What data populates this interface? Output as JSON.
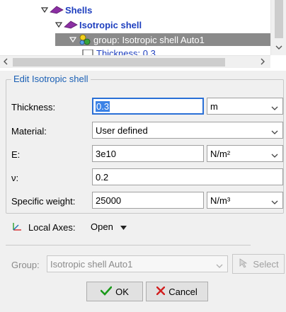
{
  "tree": {
    "items": [
      {
        "label": "Shells",
        "icon": "shell-type-icon"
      },
      {
        "label": "Isotropic shell",
        "icon": "shell-type-icon"
      },
      {
        "label": "group: Isotropic shell Auto1",
        "icon": "group-icon"
      },
      {
        "label": "Thickness: 0.3",
        "icon": "property-icon"
      }
    ]
  },
  "edit": {
    "title": "Edit Isotropic shell",
    "thickness": {
      "label": "Thickness:",
      "value": "0.3",
      "unit": "m"
    },
    "material": {
      "label": "Material:",
      "value": "User defined"
    },
    "e": {
      "label": "E:",
      "value": "3e10",
      "unit": "N/m²"
    },
    "nu": {
      "label": "ν:",
      "value": "0.2"
    },
    "specific_weight": {
      "label": "Specific weight:",
      "value": "25000",
      "unit": "N/m³"
    }
  },
  "local_axes": {
    "label": "Local Axes:",
    "value": "Open"
  },
  "group": {
    "label": "Group:",
    "value": "Isotropic shell Auto1",
    "select_label": "Select"
  },
  "buttons": {
    "ok": "OK",
    "cancel": "Cancel"
  },
  "colors": {
    "accent": "#1a5fb4",
    "selection": "#8a8a8a",
    "ok_check": "#1a9a1a",
    "cancel_x": "#d21f1f"
  }
}
